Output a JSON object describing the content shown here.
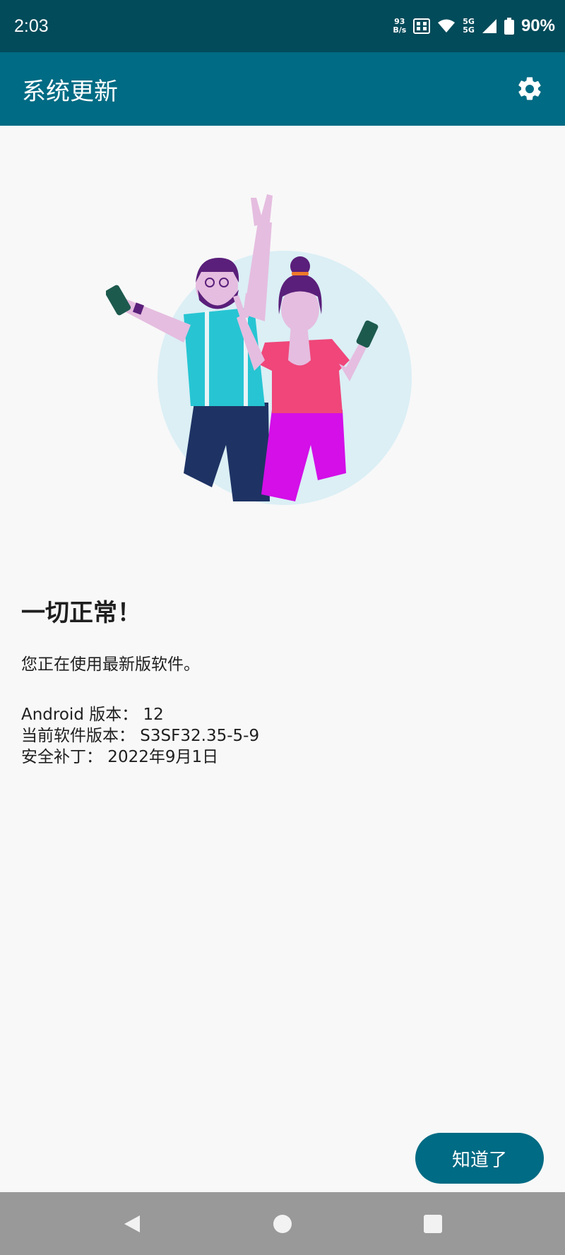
{
  "status_bar": {
    "time": "2:03",
    "net_speed_value": "93",
    "net_speed_unit": "B/s",
    "network_5g_top": "5G",
    "network_5g_bottom": "5G",
    "battery_percent": "90%"
  },
  "app_bar": {
    "title": "系统更新",
    "settings_icon": "gear-icon"
  },
  "main": {
    "headline": "一切正常！",
    "subtext": "您正在使用最新版软件。",
    "info": [
      "Android 版本： 12",
      "当前软件版本： S3SF32.35-5-9",
      "安全补丁： 2022年9月1日"
    ]
  },
  "ok_button": {
    "label": "知道了"
  },
  "nav_bar": {
    "back_icon": "back-triangle-icon",
    "home_icon": "home-circle-icon",
    "recents_icon": "recents-square-icon"
  },
  "colors": {
    "status_bar": "#024b5a",
    "app_bar": "#006b84",
    "accent": "#006b84",
    "background": "#f8f8f8",
    "nav_bar": "#999999"
  }
}
